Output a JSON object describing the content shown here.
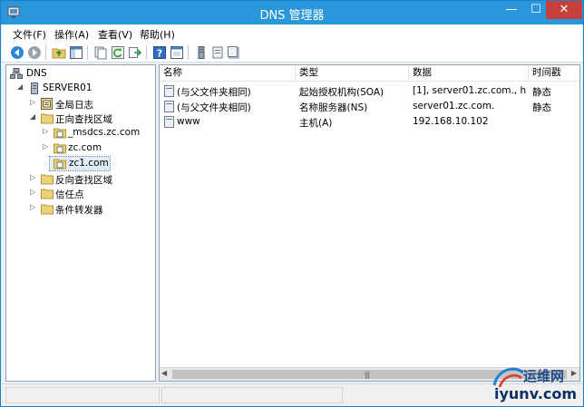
{
  "window": {
    "title": "DNS 管理器",
    "min_glyph": "—",
    "max_glyph": "☐",
    "close_glyph": "✕",
    "accent": "#2b97db",
    "close_color": "#c7413c"
  },
  "menubar": {
    "items": [
      "文件(F)",
      "操作(A)",
      "查看(V)",
      "帮助(H)"
    ]
  },
  "toolbar": {
    "icons": [
      "back-icon",
      "forward-icon",
      "up-folder-icon",
      "show-hide-tree-icon",
      "copy-icon",
      "refresh-icon",
      "export-list-icon",
      "help-icon",
      "properties-icon",
      "server-icon",
      "zone-icon",
      "record-icon"
    ]
  },
  "tree": {
    "root": "DNS",
    "server": "SERVER01",
    "global_logs": "全局日志",
    "forward_zones": "正向查找区域",
    "zone_msdcs": "_msdcs.zc.com",
    "zone_zc": "zc.com",
    "zone_zc1": "zc1.com",
    "reverse_zones": "反向查找区域",
    "trust_points": "信任点",
    "conditional_forwarders": "条件转发器"
  },
  "list": {
    "columns": [
      "名称",
      "类型",
      "数据",
      "时间戳"
    ],
    "rows": [
      {
        "name": "(与父文件夹相同)",
        "type": "起始授权机构(SOA)",
        "data": "[1], server01.zc.com., h...",
        "timestamp": "静态"
      },
      {
        "name": "(与父文件夹相同)",
        "type": "名称服务器(NS)",
        "data": "server01.zc.com.",
        "timestamp": "静态"
      },
      {
        "name": "www",
        "type": "主机(A)",
        "data": "192.168.10.102",
        "timestamp": ""
      }
    ]
  },
  "scrollbar": {
    "left_arrow": "◀",
    "right_arrow": "▶",
    "grip": "|||"
  },
  "watermark": {
    "line1": "运维网",
    "line2": "iyunv.com"
  }
}
